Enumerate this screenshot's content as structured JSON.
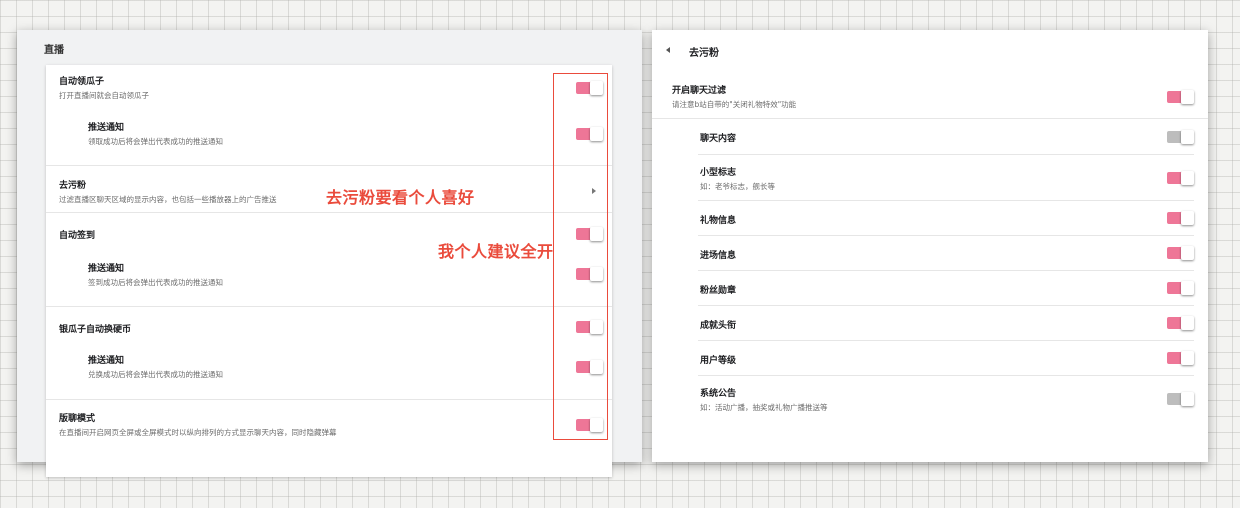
{
  "left": {
    "section_title": "直播",
    "items": [
      {
        "title": "自动领瓜子",
        "subtitle": "打开直播间就会自动领瓜子",
        "toggle_on": true
      },
      {
        "title": "推送通知",
        "subtitle": "领取成功后将会弹出代表成功的推送通知",
        "toggle_on": true
      },
      {
        "title": "去污粉",
        "subtitle": "过滤直播区聊天区域的显示内容，也包括一些播放器上的广告推送"
      },
      {
        "title": "自动签到",
        "subtitle": "",
        "toggle_on": true
      },
      {
        "title": "推送通知",
        "subtitle": "签到成功后将会弹出代表成功的推送通知",
        "toggle_on": true
      },
      {
        "title": "银瓜子自动换硬币",
        "subtitle": "",
        "toggle_on": true
      },
      {
        "title": "推送通知",
        "subtitle": "兑换成功后将会弹出代表成功的推送通知",
        "toggle_on": true
      },
      {
        "title": "版聊模式",
        "subtitle": "在直播间开启网页全屏或全屏模式时以纵向排列的方式显示聊天内容，同时隐藏弹幕",
        "toggle_on": true
      }
    ]
  },
  "annotations": {
    "note1": "去污粉要看个人喜好",
    "note2": "我个人建议全开"
  },
  "right": {
    "title": "去污粉",
    "master": {
      "title": "开启聊天过滤",
      "subtitle": "请注意b站自带的\"关闭礼物特效\"功能",
      "toggle_on": true
    },
    "items": [
      {
        "title": "聊天内容",
        "subtitle": "",
        "toggle_on": false
      },
      {
        "title": "小型标志",
        "subtitle": "如：老爷标志，舰长等",
        "toggle_on": true
      },
      {
        "title": "礼物信息",
        "subtitle": "",
        "toggle_on": true
      },
      {
        "title": "进场信息",
        "subtitle": "",
        "toggle_on": true
      },
      {
        "title": "粉丝勋章",
        "subtitle": "",
        "toggle_on": true
      },
      {
        "title": "成就头衔",
        "subtitle": "",
        "toggle_on": true
      },
      {
        "title": "用户等级",
        "subtitle": "",
        "toggle_on": true
      },
      {
        "title": "系统公告",
        "subtitle": "如：活动广播，抽奖或礼物广播推送等",
        "toggle_on": false
      }
    ]
  },
  "colors": {
    "toggle_on": "#ee7697",
    "toggle_off": "#bdbdbd",
    "annotation": "#ea4b3c"
  }
}
